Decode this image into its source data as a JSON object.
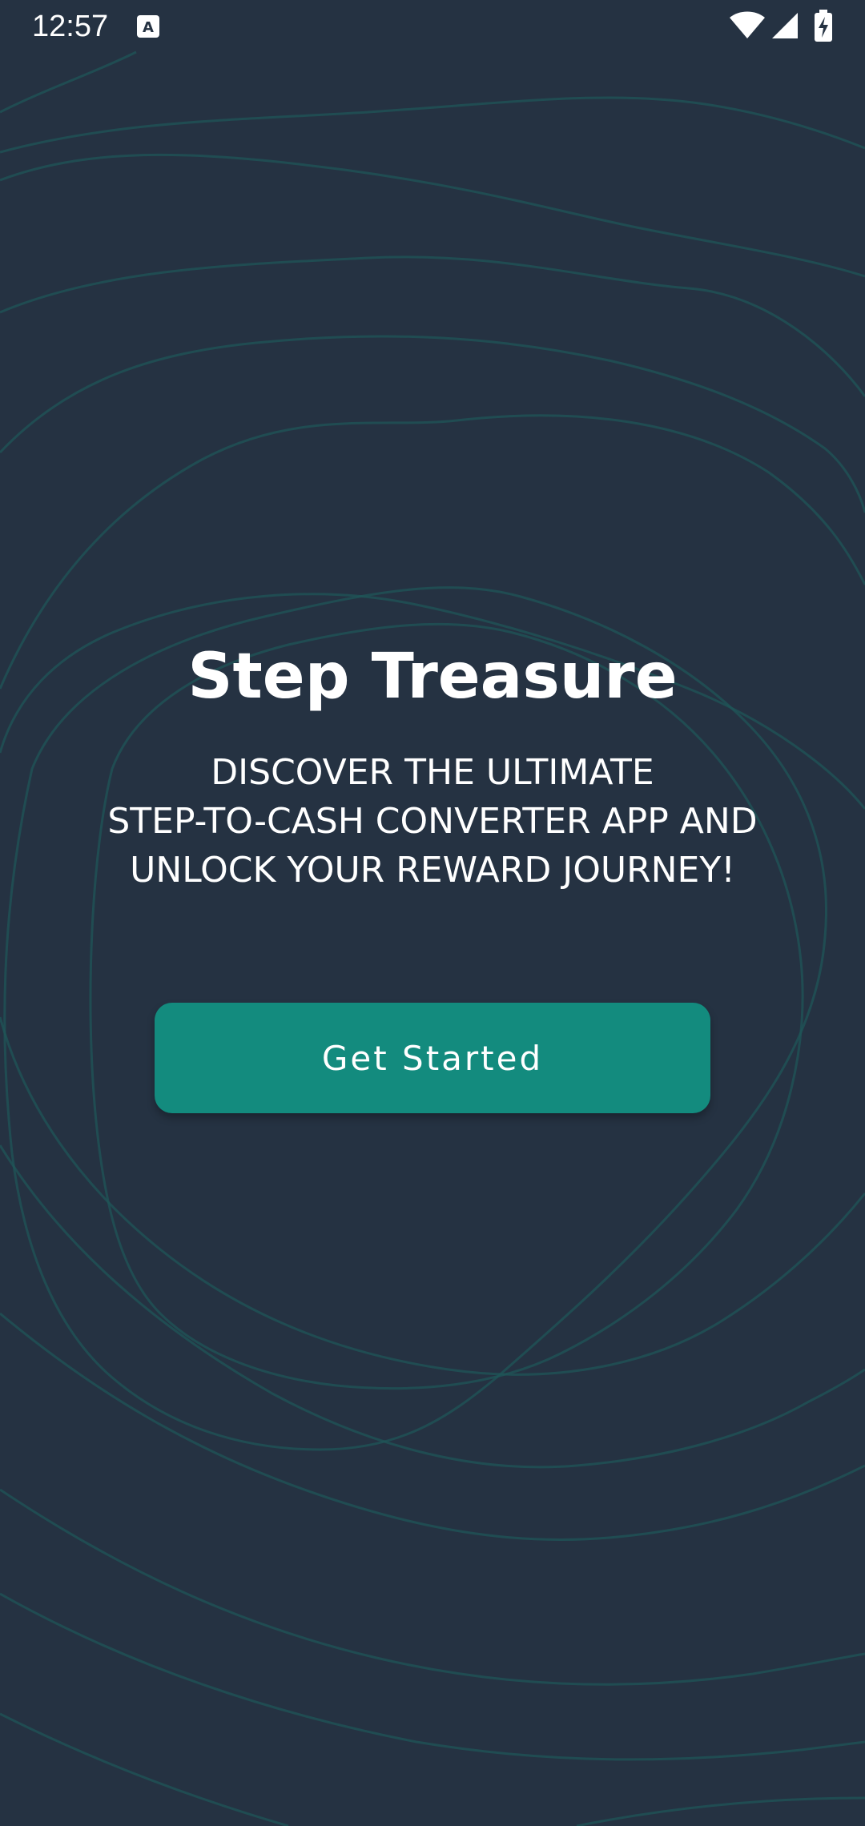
{
  "status_bar": {
    "time": "12:57",
    "icons": [
      "a-keyboard-icon",
      "wifi-icon",
      "signal-icon",
      "battery-charging-icon"
    ]
  },
  "main": {
    "title": "Step Treasure",
    "subtitle_lines": [
      "DISCOVER THE ULTIMATE",
      "STEP-TO-CASH CONVERTER APP AND",
      "UNLOCK YOUR REWARD JOURNEY!"
    ],
    "cta_label": "Get Started"
  },
  "colors": {
    "background": "#253242",
    "contour_lines": "#1f5558",
    "accent_button": "#138b7e",
    "text": "#ffffff"
  }
}
